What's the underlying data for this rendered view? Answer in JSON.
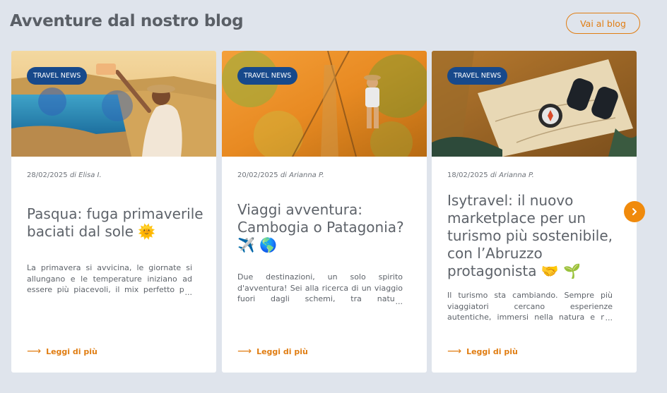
{
  "section": {
    "title": "Avventure dal nostro blog",
    "blog_button": "Vai al blog"
  },
  "cards": [
    {
      "badge": "TRAVEL NEWS",
      "date": "28/02/2025",
      "author": "di Elisa I.",
      "title": "Pasqua: fuga primaverile baciati dal sole 🌞",
      "excerpt": "La primavera si avvicina, le giornate si allungano e le temperature iniziano ad essere più piacevoli, il mix perfetto per pianificare una fuga all'insegna del sole",
      "read_more": "Leggi di più"
    },
    {
      "badge": "TRAVEL NEWS",
      "date": "20/02/2025",
      "author": "di Arianna P.",
      "title": "Viaggi avventura: Cambogia o Patagonia? ✈️ 🌎",
      "excerpt": "Due destinazioni, un solo spirito d'avventura! Sei alla ricerca di un viaggio fuori dagli schemi, tra natura incontaminata e paesaggi mozzafiato?",
      "read_more": "Leggi di più"
    },
    {
      "badge": "TRAVEL NEWS",
      "date": "18/02/2025",
      "author": "di Arianna P.",
      "title": "Isytravel: il nuovo marketplace per un turismo più sostenibile, con l’Abruzzo protagonista 🤝 🌱",
      "excerpt": "Il turismo sta cambiando. Sempre più viaggiatori cercano esperienze autentiche, immersi nella natura e nel rispetto del territorio che li ospita",
      "read_more": "Leggi di più"
    }
  ],
  "icons": {
    "read_more": "arrow-right-icon",
    "next": "chevron-right-icon"
  },
  "colors": {
    "accent": "#e07d12",
    "badge": "#17498b",
    "background": "#dfe4ec",
    "text": "#5e636a"
  }
}
